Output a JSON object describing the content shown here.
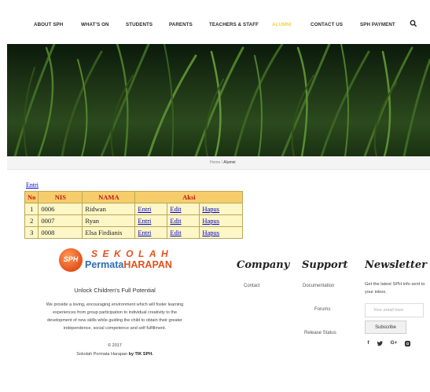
{
  "nav": {
    "items": [
      {
        "label": "ABOUT SPH"
      },
      {
        "label": "WHAT'S ON"
      },
      {
        "label": "STUDENTS"
      },
      {
        "label": "PARENTS"
      },
      {
        "label": "TEACHERS & STAFF"
      },
      {
        "label": "ALUMNI"
      },
      {
        "label": "CONTACT US"
      },
      {
        "label": "SPH PAYMENT"
      }
    ],
    "search_icon": "search-icon",
    "active_color": "#f3d24a"
  },
  "breadcrumb": {
    "home": "Home",
    "separator": "/",
    "current": "Alumni"
  },
  "alumni": {
    "entri_link": "Entri",
    "headers": {
      "no": "No",
      "nis": "NIS",
      "nama": "NAMA",
      "aksi": "Aksi"
    },
    "rows": [
      {
        "no": "1",
        "nis": "0006",
        "nama": "Ridwan",
        "entri": "Entri",
        "edit": "Edit",
        "hapus": "Hapus"
      },
      {
        "no": "2",
        "nis": "0007",
        "nama": "Ryan",
        "entri": "Entri",
        "edit": "Edit",
        "hapus": "Hapus"
      },
      {
        "no": "3",
        "nis": "0008",
        "nama": "Elsa Firdianis",
        "entri": "Entri",
        "edit": "Edit",
        "hapus": "Hapus"
      }
    ]
  },
  "footer": {
    "logo": {
      "badge": "SPH",
      "top": "SEKOLAH",
      "bottom_1": "Permata",
      "bottom_2": "HARAPAN"
    },
    "tagline": "Unlock Children's Full Potential",
    "about_lines": [
      "We provide a loving, encouraging environment which will foster learning",
      "experiences from group participation to individual creativity to the",
      "development of new skills while guiding the child to obtain their greater",
      "independence, social competence and self fulfillment."
    ],
    "copyright": "© 2017",
    "credit_prefix": "Sokolah Pormata Harapan",
    "credit_by": "by TIK SPH.",
    "company": {
      "heading": "Company",
      "links": [
        "Contact"
      ]
    },
    "support": {
      "heading": "Support",
      "links": [
        "Documentation",
        "Forums",
        "Release Status"
      ]
    },
    "newsletter": {
      "heading": "Newsletter",
      "text": "Get the latest SPH info sent to your inbox.",
      "placeholder": "Your email here",
      "button": "Subscribe",
      "social": [
        "f",
        "twitter-icon",
        "G+",
        "instagram-icon"
      ]
    }
  },
  "colors": {
    "header_bg": "#f6cd6a",
    "header_text": "#c0141a",
    "table_bg": "#fdf6c7",
    "link": "#0000cc",
    "logo_orange": "#e4511b",
    "logo_blue": "#2d6db5"
  }
}
